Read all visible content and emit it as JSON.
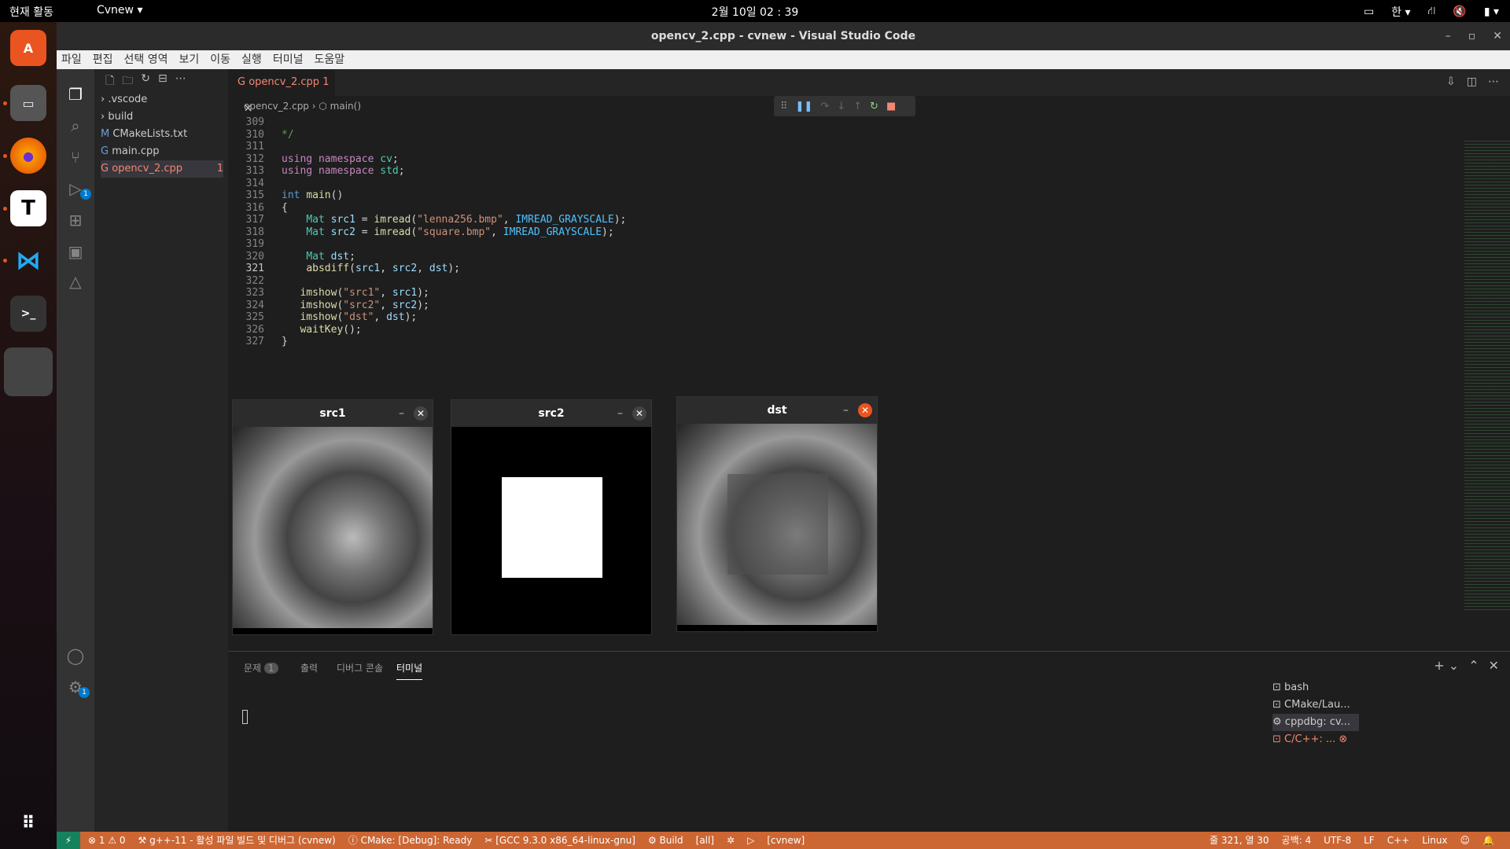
{
  "topbar": {
    "activities": "현재 활동",
    "app": "Cvnew ▾",
    "clock": "2월 10일 02 : 39",
    "ime": "한 ▾"
  },
  "window": {
    "title": "opencv_2.cpp - cvnew - Visual Studio Code"
  },
  "menu": [
    "파일",
    "편집",
    "선택 영역",
    "보기",
    "이동",
    "실행",
    "터미널",
    "도움말"
  ],
  "explorer": {
    "items": [
      {
        "label": ".vscode",
        "type": "folder"
      },
      {
        "label": "build",
        "type": "folder"
      },
      {
        "label": "CMakeLists.txt",
        "type": "cmake"
      },
      {
        "label": "main.cpp",
        "type": "cpp"
      },
      {
        "label": "opencv_2.cpp",
        "type": "cpp",
        "badge": "1"
      }
    ]
  },
  "tab": {
    "label": "opencv_2.cpp",
    "badge": "1"
  },
  "breadcrumb": {
    "file": "opencv_2.cpp",
    "symbol": "main()"
  },
  "code_lines": [
    {
      "n": "309",
      "t": ""
    },
    {
      "n": "310",
      "t": "*/"
    },
    {
      "n": "311",
      "t": ""
    },
    {
      "n": "312",
      "t": "using namespace cv;"
    },
    {
      "n": "313",
      "t": "using namespace std;"
    },
    {
      "n": "314",
      "t": ""
    },
    {
      "n": "315",
      "t": "int main()"
    },
    {
      "n": "316",
      "t": "{"
    },
    {
      "n": "317",
      "t": "    Mat src1 = imread(\"lenna256.bmp\", IMREAD_GRAYSCALE);"
    },
    {
      "n": "318",
      "t": "    Mat src2 = imread(\"square.bmp\", IMREAD_GRAYSCALE);"
    },
    {
      "n": "319",
      "t": ""
    },
    {
      "n": "320",
      "t": "    Mat dst;"
    },
    {
      "n": "321",
      "t": "    absdiff(src1, src2, dst);"
    },
    {
      "n": "322",
      "t": ""
    },
    {
      "n": "323",
      "t": "   imshow(\"src1\", src1);"
    },
    {
      "n": "324",
      "t": "   imshow(\"src2\", src2);"
    },
    {
      "n": "325",
      "t": "   imshow(\"dst\", dst);"
    },
    {
      "n": "326",
      "t": "   waitKey();"
    },
    {
      "n": "327",
      "t": "}"
    }
  ],
  "cv_windows": [
    {
      "title": "src1"
    },
    {
      "title": "src2"
    },
    {
      "title": "dst"
    }
  ],
  "panel": {
    "tabs": [
      "문제",
      "출력",
      "디버그 콘솔",
      "터미널"
    ],
    "problems_count": "1"
  },
  "terminals": [
    "bash",
    "CMake/Lau...",
    "cppdbg: cv...",
    "C/C++: ..."
  ],
  "status": {
    "errors": "⊗ 1 ⚠ 0",
    "task": "g++-11 - 활성 파일 빌드 및 디버그 (cvnew)",
    "cmake": "CMake: [Debug]: Ready",
    "kit": "[GCC 9.3.0 x86_64-linux-gnu]",
    "build": "Build",
    "target": "[all]",
    "project": "[cvnew]",
    "position": "줄 321, 열 30",
    "spaces": "공백: 4",
    "encoding": "UTF-8",
    "eol": "LF",
    "lang": "C++",
    "os": "Linux"
  }
}
